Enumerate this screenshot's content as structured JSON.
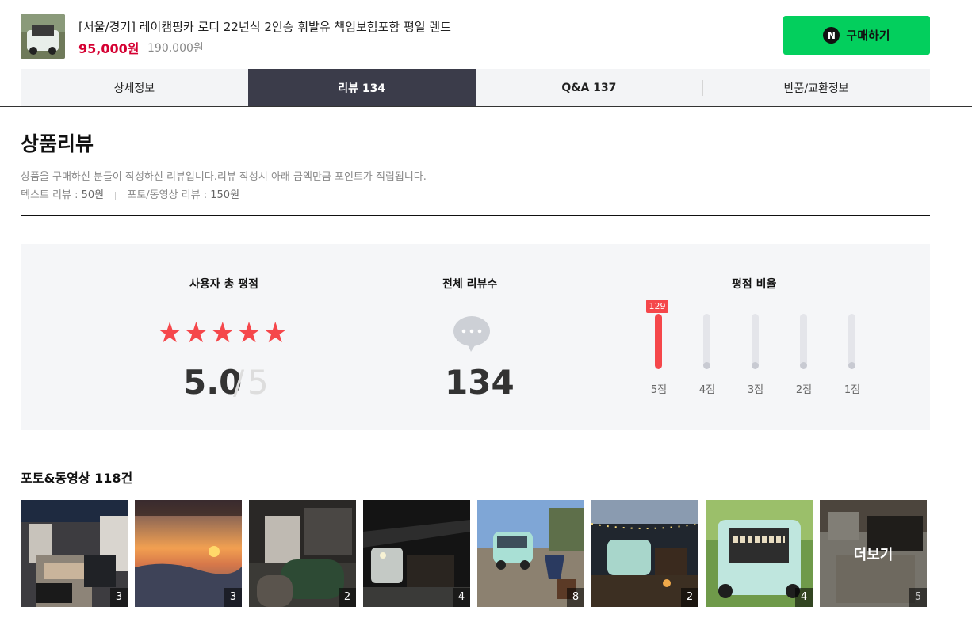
{
  "product": {
    "title": "[서울/경기] 레이캠핑카 로디 22년식 2인승 휘발유 책임보험포함 평일 렌트",
    "price": "95,000원",
    "original_price": "190,000원",
    "buy_label": "구매하기",
    "buy_icon_letter": "N",
    "buy_color": "#03cf5d"
  },
  "tabs": [
    {
      "label": "상세정보"
    },
    {
      "label": "리뷰 134"
    },
    {
      "label": "Q&A 137"
    },
    {
      "label": "반품/교환정보"
    }
  ],
  "review": {
    "title": "상품리뷰",
    "desc": "상품을 구매하신 분들이 작성하신 리뷰입니다.리뷰 작성시 아래 금액만큼 포인트가 적립됩니다.",
    "text_review_label": "텍스트 리뷰 : ",
    "text_review_point": "50원",
    "photo_review_label": "포토/동영상 리뷰 : ",
    "photo_review_point": "150원"
  },
  "summary": {
    "rating_label": "사용자 총 평점",
    "rating": "5.0",
    "slash": "/",
    "rating_max": "5",
    "stars": "★★★★★",
    "count_label": "전체 리뷰수",
    "count": "134",
    "ratio_label": "평점 비율",
    "accent_color": "#f5474b",
    "ratios": [
      {
        "label": "5점",
        "count": 129,
        "top_badge": "129"
      },
      {
        "label": "4점",
        "count": 0
      },
      {
        "label": "3점",
        "count": 0
      },
      {
        "label": "2점",
        "count": 0
      },
      {
        "label": "1점",
        "count": 0
      }
    ]
  },
  "photos": {
    "title_prefix": "포토&동영상 ",
    "title_count": "118건",
    "more_label": "더보기",
    "items": [
      {
        "count": "3"
      },
      {
        "count": "3"
      },
      {
        "count": "2"
      },
      {
        "count": "4"
      },
      {
        "count": "8"
      },
      {
        "count": "2"
      },
      {
        "count": "4"
      },
      {
        "count": "5"
      }
    ]
  }
}
